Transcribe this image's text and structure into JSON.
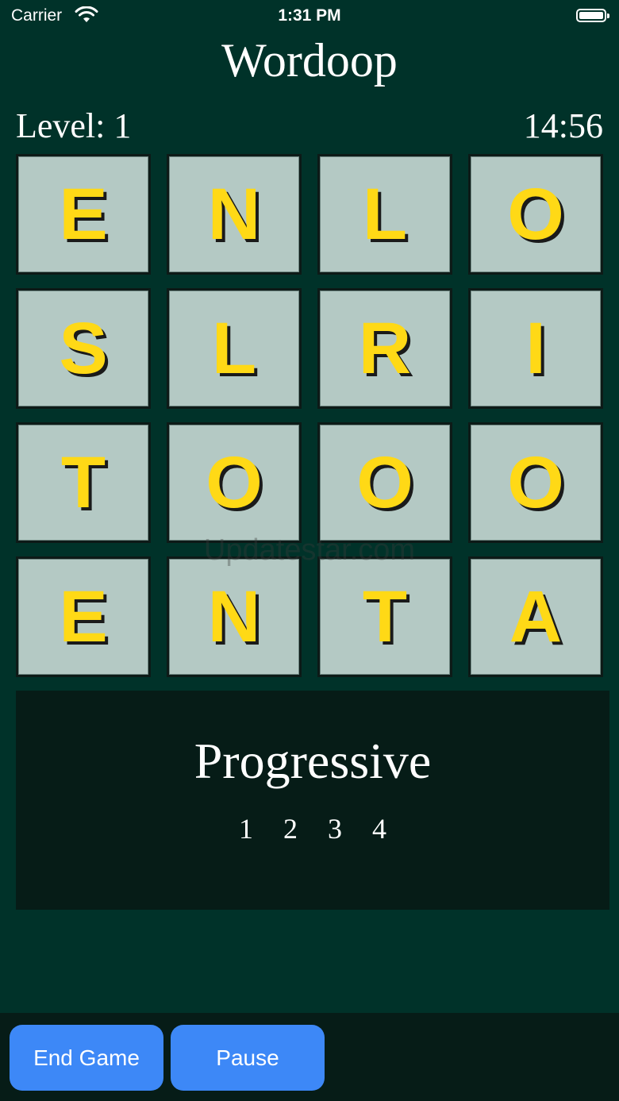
{
  "status_bar": {
    "carrier": "Carrier",
    "time": "1:31 PM",
    "wifi_icon": "wifi-icon",
    "battery_icon": "battery-icon"
  },
  "header": {
    "title": "Wordoop",
    "level": "Level: 1",
    "timer": "14:56"
  },
  "board": {
    "tiles": [
      [
        "E",
        "N",
        "L",
        "O"
      ],
      [
        "S",
        "L",
        "R",
        "I"
      ],
      [
        "T",
        "O",
        "O",
        "O"
      ],
      [
        "E",
        "N",
        "T",
        "A"
      ]
    ],
    "tile_color": "#b4c9c4",
    "letter_color": "#ffd916"
  },
  "watermark": "Updatestar.com",
  "progress": {
    "title": "Progressive",
    "steps": [
      "1",
      "2",
      "3",
      "4"
    ]
  },
  "toolbar": {
    "end_game_label": "End Game",
    "pause_label": "Pause",
    "button_color": "#3d88f7"
  },
  "colors": {
    "background": "#003229",
    "panel": "#061c17"
  }
}
